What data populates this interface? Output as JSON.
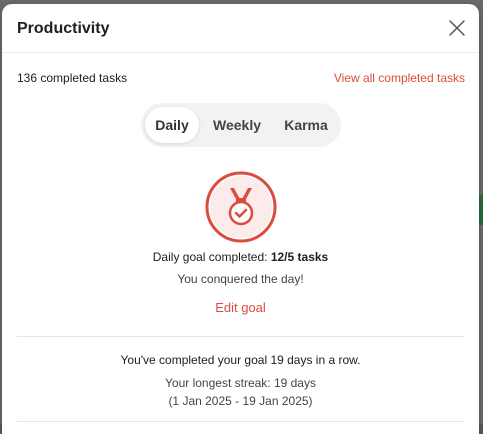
{
  "dialog": {
    "title": "Productivity",
    "completed_count": "136 completed tasks",
    "view_all_label": "View all completed tasks"
  },
  "tabs": [
    {
      "label": "Daily",
      "active": true
    },
    {
      "label": "Weekly",
      "active": false
    },
    {
      "label": "Karma",
      "active": false
    }
  ],
  "goal": {
    "prefix": "Daily goal completed: ",
    "value": "12/5 tasks",
    "message": "You conquered the day!",
    "edit_label": "Edit goal"
  },
  "streak": {
    "current": "You've completed your goal 19 days in a row.",
    "longest": "Your longest streak: 19 days",
    "range": "(1 Jan 2025 - 19 Jan 2025)"
  },
  "colors": {
    "accent": "#dc4c3e"
  },
  "icons": {
    "close": "close-icon",
    "medal": "medal-icon"
  }
}
